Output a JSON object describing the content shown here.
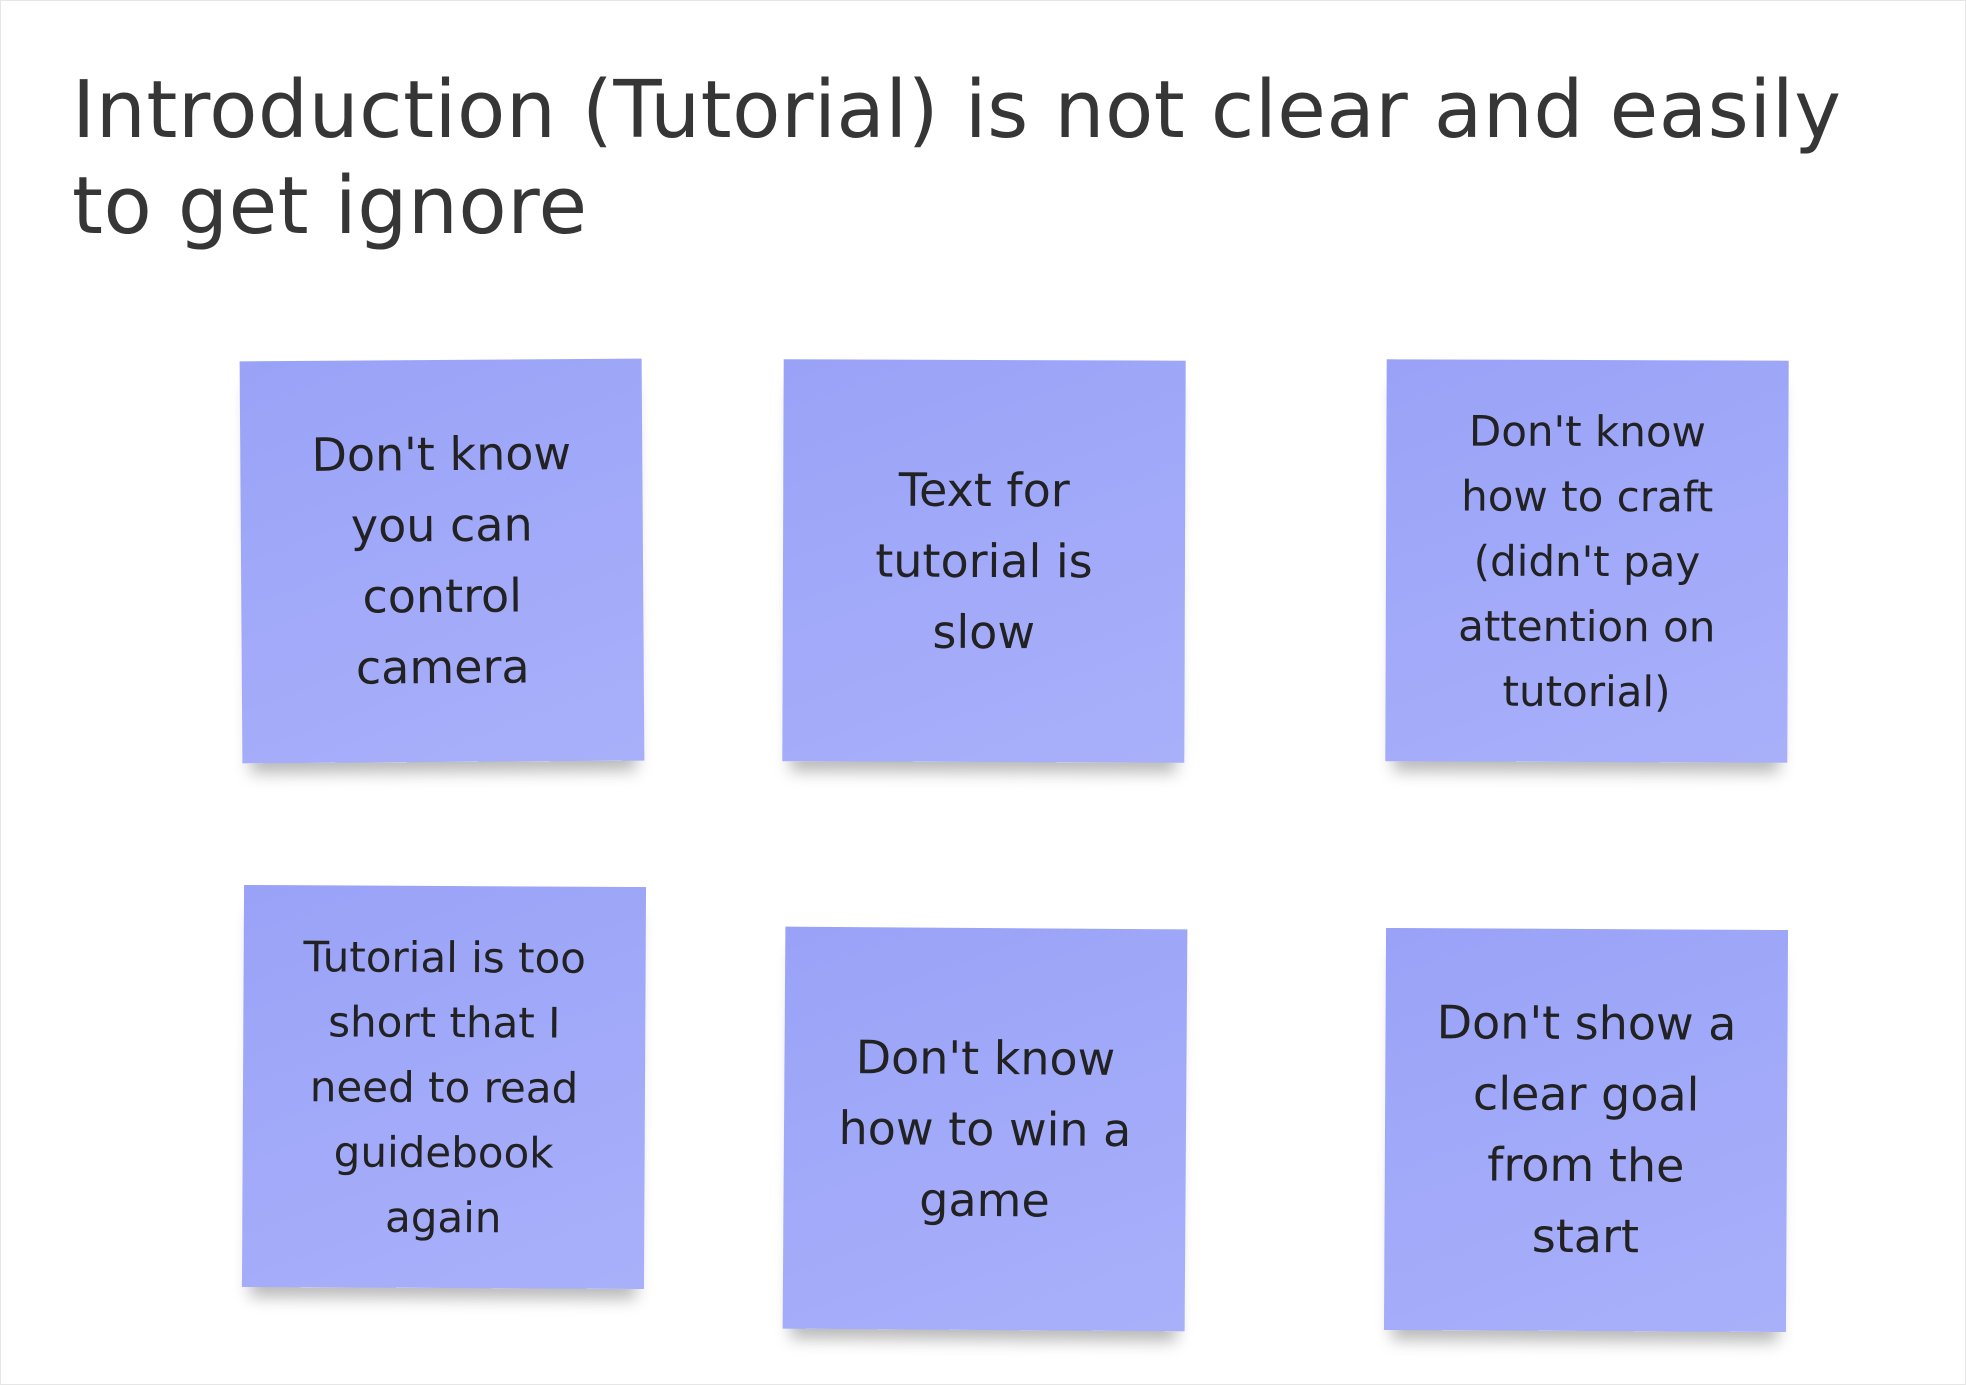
{
  "board": {
    "title": "Introduction (Tutorial) is not clear and easily to get ignore"
  },
  "notes": [
    {
      "text": "Don't know\nyou can\ncontrol\ncamera",
      "color": "#a1a9f9"
    },
    {
      "text": "Text for\ntutorial is\nslow",
      "color": "#a1a9f9"
    },
    {
      "text": "Don't know\nhow to craft\n(didn't pay\nattention on\ntutorial)",
      "color": "#a1a9f9"
    },
    {
      "text": "Tutorial is too\nshort that I\nneed to read\nguidebook\nagain",
      "color": "#a1a9f9"
    },
    {
      "text": "Don't know\nhow to win a\ngame",
      "color": "#a1a9f9"
    },
    {
      "text": "Don't show a\nclear goal\nfrom the\nstart",
      "color": "#a1a9f9"
    }
  ]
}
